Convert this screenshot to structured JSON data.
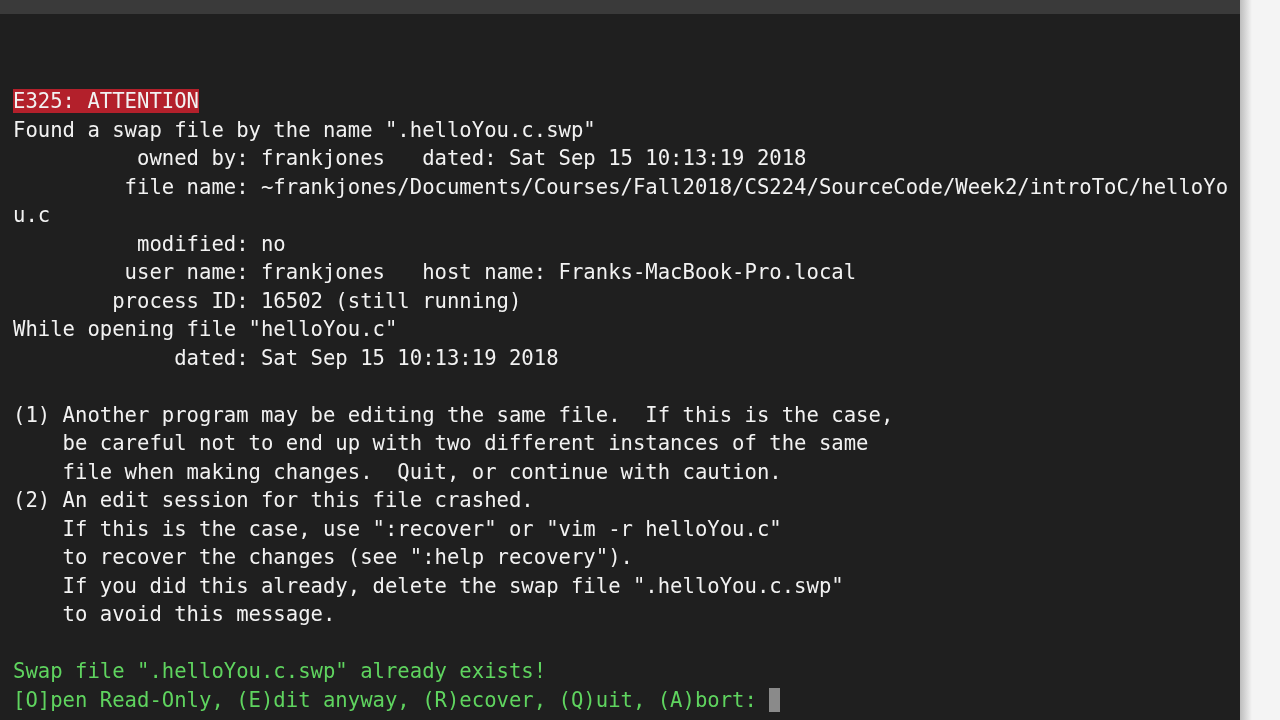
{
  "terminal": {
    "lines": [
      {
        "kind": "error",
        "text": "E325: ATTENTION"
      },
      {
        "kind": "normal",
        "text": "Found a swap file by the name \".helloYou.c.swp\""
      },
      {
        "kind": "normal",
        "text": "          owned by: frankjones   dated: Sat Sep 15 10:13:19 2018"
      },
      {
        "kind": "normal",
        "text": "         file name: ~frankjones/Documents/Courses/Fall2018/CS224/SourceCode/Week2/introToC/helloYo"
      },
      {
        "kind": "normal",
        "text": "u.c"
      },
      {
        "kind": "normal",
        "text": "          modified: no"
      },
      {
        "kind": "normal",
        "text": "         user name: frankjones   host name: Franks-MacBook-Pro.local"
      },
      {
        "kind": "normal",
        "text": "        process ID: 16502 (still running)"
      },
      {
        "kind": "normal",
        "text": "While opening file \"helloYou.c\""
      },
      {
        "kind": "normal",
        "text": "             dated: Sat Sep 15 10:13:19 2018"
      },
      {
        "kind": "blank"
      },
      {
        "kind": "normal",
        "text": "(1) Another program may be editing the same file.  If this is the case,"
      },
      {
        "kind": "normal",
        "text": "    be careful not to end up with two different instances of the same"
      },
      {
        "kind": "normal",
        "text": "    file when making changes.  Quit, or continue with caution."
      },
      {
        "kind": "normal",
        "text": "(2) An edit session for this file crashed."
      },
      {
        "kind": "normal",
        "text": "    If this is the case, use \":recover\" or \"vim -r helloYou.c\""
      },
      {
        "kind": "normal",
        "text": "    to recover the changes (see \":help recovery\")."
      },
      {
        "kind": "normal",
        "text": "    If you did this already, delete the swap file \".helloYou.c.swp\""
      },
      {
        "kind": "normal",
        "text": "    to avoid this message."
      },
      {
        "kind": "blank"
      },
      {
        "kind": "warning",
        "text": "Swap file \".helloYou.c.swp\" already exists!"
      },
      {
        "kind": "prompt",
        "text": "[O]pen Read-Only, (E)dit anyway, (R)ecover, (Q)uit, (A)bort: "
      }
    ]
  }
}
